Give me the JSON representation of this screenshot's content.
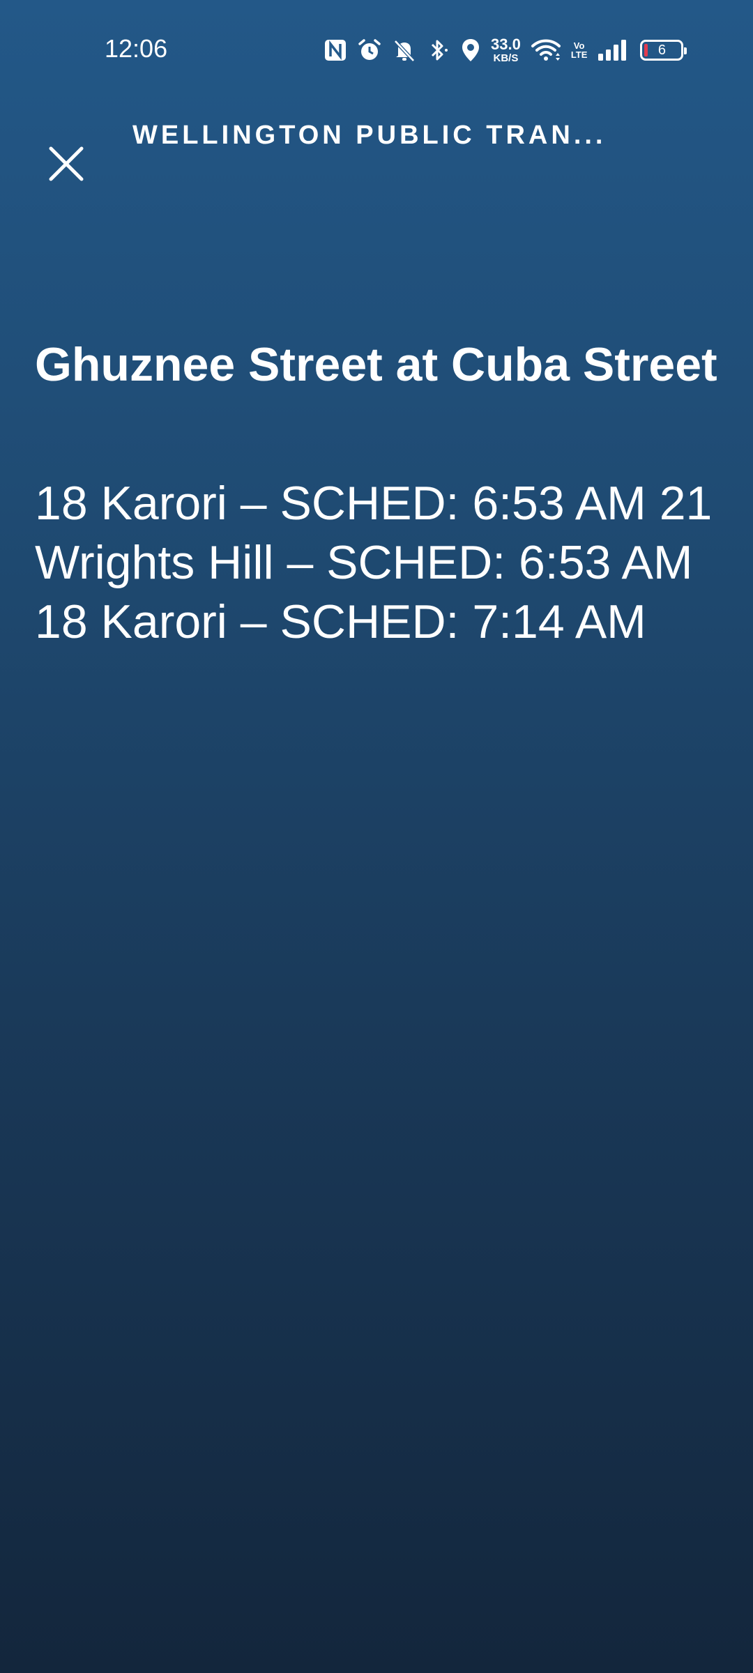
{
  "status_bar": {
    "time": "12:06",
    "net_speed_value": "33.0",
    "net_speed_unit": "KB/S",
    "volte_top": "Vo",
    "volte_bottom": "LTE",
    "battery_level": "6",
    "icons": [
      "nfc-icon",
      "alarm-icon",
      "bell-muted-icon",
      "bluetooth-icon",
      "location-icon",
      "wifi-icon",
      "signal-icon",
      "battery-icon"
    ]
  },
  "header": {
    "title": "WELLINGTON PUBLIC TRAN..."
  },
  "stop": {
    "title": "Ghuznee Street at Cuba Street",
    "departures_text": "18 Karori – SCHED: 6:53 AM 21 Wrights Hill – SCHED: 6:53 AM 18 Karori – SCHED: 7:14 AM"
  },
  "colors": {
    "background_top": "#235888",
    "background_bottom": "#13263c",
    "text": "#ffffff",
    "battery_low": "#e23b4e"
  }
}
